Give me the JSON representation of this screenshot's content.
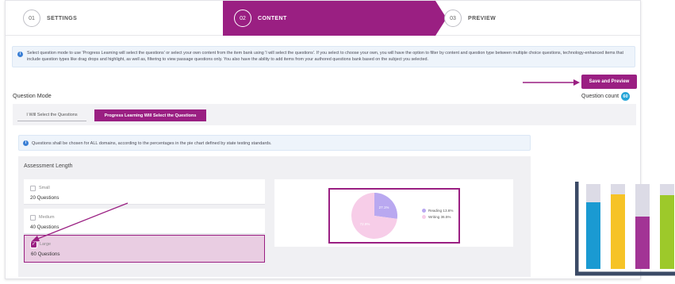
{
  "steps": [
    {
      "num": "01",
      "label": "SETTINGS"
    },
    {
      "num": "02",
      "label": "CONTENT"
    },
    {
      "num": "03",
      "label": "PREVIEW"
    }
  ],
  "info_text": "Select question mode to use 'Progress Learning will select the questions' or select your own content from the item bank using 'I will select the questions'. If you select to choose your own, you will have the option to filter by content and question type between multiple choice questions, technology-enhanced items that include question types like drag drops and highlight, as well as, filtering to view passage questions only. You also have the ability to add items from your authored questions bank based on the subject you selected.",
  "question_mode_label": "Question Mode",
  "save_button": "Save and Preview",
  "question_count_label": "Question count",
  "question_count": "60",
  "tabs": {
    "manual": "I Will Select the Questions",
    "auto": "Progress Learning Will Select the Questions"
  },
  "domains_info": "Questions shall be chosen for ALL domains, according to the percentages in the pie chart defined by state testing standards.",
  "assessment_length_title": "Assessment Length",
  "length_options": [
    {
      "name": "Small",
      "count": "20 Questions",
      "checked": false
    },
    {
      "name": "Medium",
      "count": "40 Questions",
      "checked": false
    },
    {
      "name": "Large",
      "count": "60 Questions",
      "checked": true
    }
  ],
  "chart_data": {
    "type": "pie",
    "series": [
      {
        "name": "Reading 13.6%",
        "value": 27.1,
        "slice_label": "27.1%",
        "color": "#b9a8f0"
      },
      {
        "name": "Writing 36.5%",
        "value": 72.9,
        "slice_label": "72.9%",
        "color": "#f7cde8"
      }
    ]
  },
  "colors": {
    "accent": "#9a1f82",
    "info_bg": "#eef4fb",
    "badge": "#27a6d8"
  }
}
